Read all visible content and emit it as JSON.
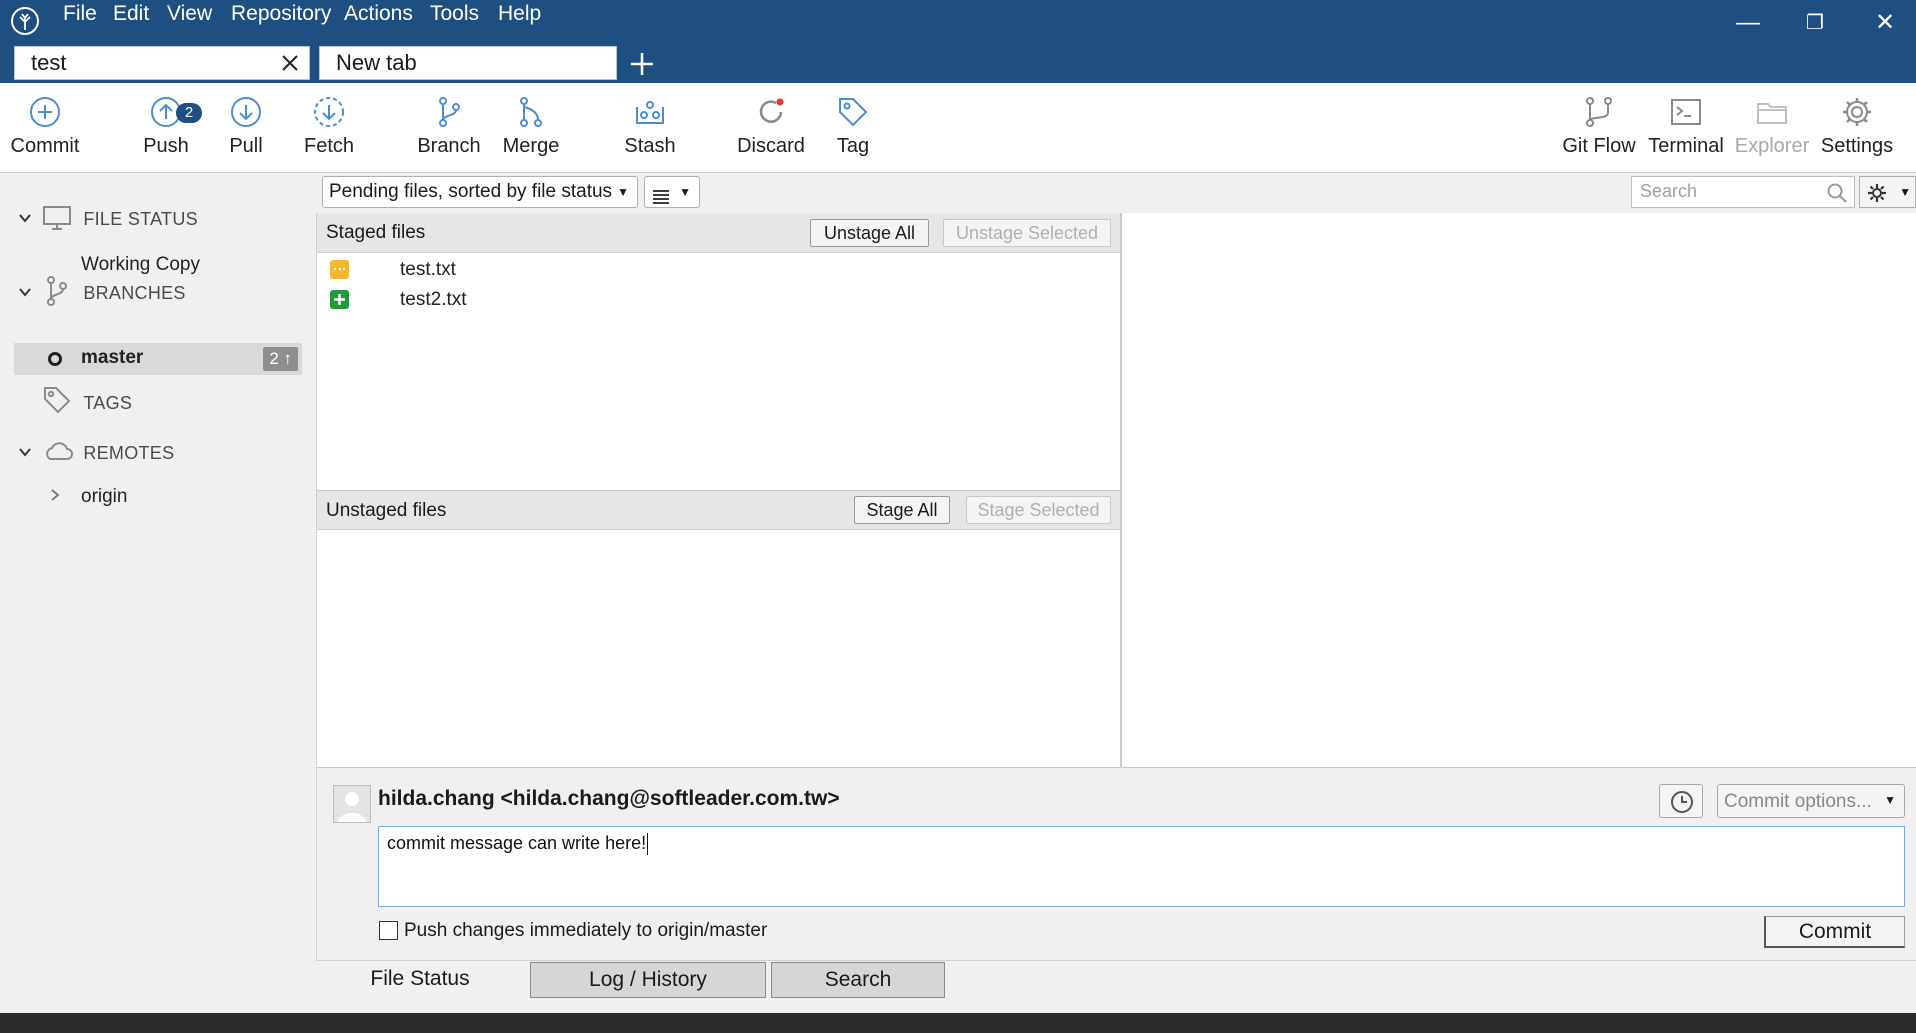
{
  "menu": [
    "File",
    "Edit",
    "View",
    "Repository",
    "Actions",
    "Tools",
    "Help"
  ],
  "tabs": [
    {
      "label": "test"
    },
    {
      "label": "New tab"
    }
  ],
  "window": {
    "minimize": "—",
    "restore": "❐",
    "close": "✕"
  },
  "toolbar": {
    "left": [
      {
        "label": "Commit",
        "icon": "commit-icon"
      },
      {
        "label": "Push",
        "icon": "push-icon",
        "badge": "2"
      },
      {
        "label": "Pull",
        "icon": "pull-icon"
      },
      {
        "label": "Fetch",
        "icon": "fetch-icon"
      },
      {
        "label": "Branch",
        "icon": "branch-icon"
      },
      {
        "label": "Merge",
        "icon": "merge-icon"
      },
      {
        "label": "Stash",
        "icon": "stash-icon"
      },
      {
        "label": "Discard",
        "icon": "discard-icon"
      },
      {
        "label": "Tag",
        "icon": "tag-icon"
      }
    ],
    "right": [
      {
        "label": "Git Flow",
        "icon": "git-flow-icon"
      },
      {
        "label": "Terminal",
        "icon": "terminal-icon"
      },
      {
        "label": "Explorer",
        "icon": "explorer-icon"
      },
      {
        "label": "Settings",
        "icon": "settings-icon"
      }
    ]
  },
  "sidebar": {
    "file_status": {
      "title": "FILE STATUS",
      "items": [
        "Working Copy"
      ]
    },
    "branches": {
      "title": "BRANCHES",
      "items": [
        {
          "name": "master",
          "ahead": "2 ↑"
        }
      ]
    },
    "tags": {
      "title": "TAGS"
    },
    "remotes": {
      "title": "REMOTES",
      "items": [
        "origin"
      ]
    }
  },
  "filter": {
    "sort": "Pending files, sorted by file status",
    "search_placeholder": "Search"
  },
  "staged": {
    "title": "Staged files",
    "unstage_all": "Unstage All",
    "unstage_selected": "Unstage Selected",
    "files": [
      {
        "name": "test.txt",
        "status": "modified"
      },
      {
        "name": "test2.txt",
        "status": "added"
      }
    ]
  },
  "unstaged": {
    "title": "Unstaged files",
    "stage_all": "Stage All",
    "stage_selected": "Stage Selected"
  },
  "commit": {
    "author": "hilda.chang <hilda.chang@softleader.com.tw>",
    "options": "Commit options...",
    "message": "commit message can write here!",
    "push_checkbox_label": "Push changes immediately to origin/master",
    "push_checked": false,
    "button": "Commit"
  },
  "bottom_tabs": [
    "File Status",
    "Log / History",
    "Search"
  ],
  "colors": {
    "titlebar": "#1f4f80",
    "modified": "#f5b731",
    "added": "#1e9c3a"
  }
}
